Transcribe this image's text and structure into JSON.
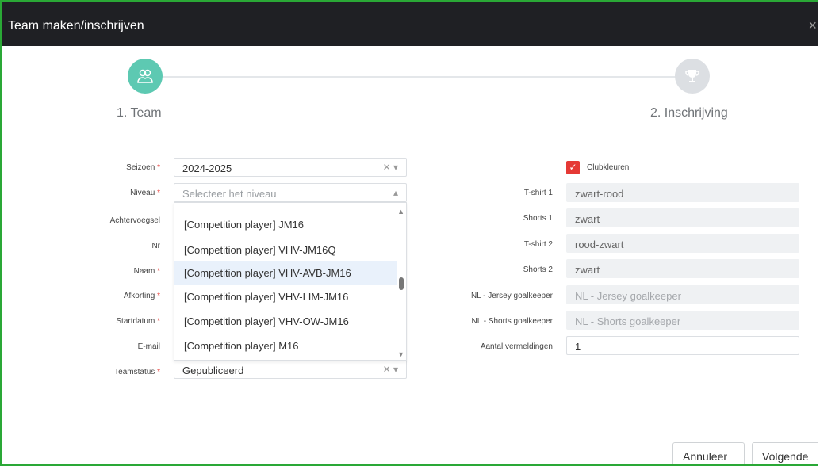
{
  "dialog": {
    "title": "Team maken/inschrijven",
    "close_glyph": "×"
  },
  "steps": [
    {
      "label": "1. Team",
      "icon": "team-icon",
      "color": "#5dc9b2"
    },
    {
      "label": "2. Inschrijving",
      "icon": "trophy-icon",
      "color": "#dcdfe3"
    }
  ],
  "left_form": {
    "season": {
      "label": "Seizoen",
      "value": "2024-2025"
    },
    "level": {
      "label": "Niveau",
      "placeholder": "Selecteer het niveau"
    },
    "suffix": {
      "label": "Achtervoegsel"
    },
    "nr": {
      "label": "Nr"
    },
    "name": {
      "label": "Naam"
    },
    "abbr": {
      "label": "Afkorting"
    },
    "startdate": {
      "label": "Startdatum"
    },
    "email": {
      "label": "E-mail"
    },
    "teamstatus": {
      "label": "Teamstatus",
      "value": "Gepubliceerd"
    },
    "required_mark": "*"
  },
  "level_options": [
    "[Competition player] JM16",
    "[Competition player] VHV-JM16Q",
    "[Competition player] VHV-AVB-JM16",
    "[Competition player] VHV-LIM-JM16",
    "[Competition player] VHV-OW-JM16",
    "[Competition player] M16"
  ],
  "right_form": {
    "clubcolors": {
      "label": "Clubkleuren",
      "checked": true
    },
    "tshirt1": {
      "label": "T-shirt 1",
      "value": "zwart-rood"
    },
    "shorts1": {
      "label": "Shorts 1",
      "value": "zwart"
    },
    "tshirt2": {
      "label": "T-shirt 2",
      "value": "rood-zwart"
    },
    "shorts2": {
      "label": "Shorts 2",
      "value": "zwart"
    },
    "jersey_gk": {
      "label": "NL - Jersey goalkeeper",
      "placeholder": "NL - Jersey goalkeeper"
    },
    "shorts_gk": {
      "label": "NL - Shorts goalkeeper",
      "placeholder": "NL - Shorts goalkeeper"
    },
    "mentions": {
      "label": "Aantal vermeldingen",
      "value": "1"
    }
  },
  "footer": {
    "cancel": "Annuleer",
    "next": "Volgende"
  },
  "colors": {
    "accent": "#5dc9b2",
    "checkbox": "#e53935",
    "frame": "#2aa836"
  }
}
